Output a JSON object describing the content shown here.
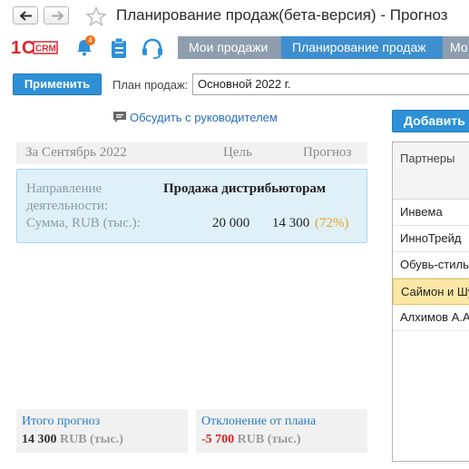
{
  "window": {
    "title": "Планирование продаж(бета-версия) - Прогноз"
  },
  "brand": {
    "logo_text": "1C:CRM"
  },
  "toolbar": {
    "notifications_count": "4"
  },
  "tabs": [
    {
      "label": "Мои продажи"
    },
    {
      "label": "Планирование продаж"
    },
    {
      "label": "Мо"
    }
  ],
  "commands": {
    "apply_label": "Применить",
    "plan_label": "План продаж:",
    "plan_value": "Основной 2022 г."
  },
  "discuss_link": "Обсудить с руководителем",
  "period": {
    "label": "За Сентябрь 2022",
    "goal_header": "Цель",
    "forecast_header": "Прогноз"
  },
  "card": {
    "direction_label": "Направление деятельности:",
    "direction_value": "Продажа дистрибьюторам",
    "sum_label": "Сумма, RUB (тыс.):",
    "goal_value": "20 000",
    "forecast_value": "14 300",
    "forecast_percent": "(72%)"
  },
  "summary": {
    "total_title": "Итого прогноз",
    "total_value": "14 300",
    "total_unit": "RUB (тыс.)",
    "deviation_title": "Отклонение от плана",
    "deviation_value": "-5 700",
    "deviation_unit": "RUB (тыс.)"
  },
  "right": {
    "add_label": "Добавить",
    "column_header": "Партнеры",
    "rows": [
      "Инвема",
      "ИнноТрейд",
      "Обувь-стиль",
      "Саймон и Шу",
      "Алхимов А.А"
    ]
  },
  "colors": {
    "accent": "#2e90d6",
    "tab_bg": "#8e9eae",
    "tab_active": "#3d8fcf",
    "percent": "#e8a31b",
    "negative": "#d62020",
    "selected_row": "#fbe8a6"
  }
}
